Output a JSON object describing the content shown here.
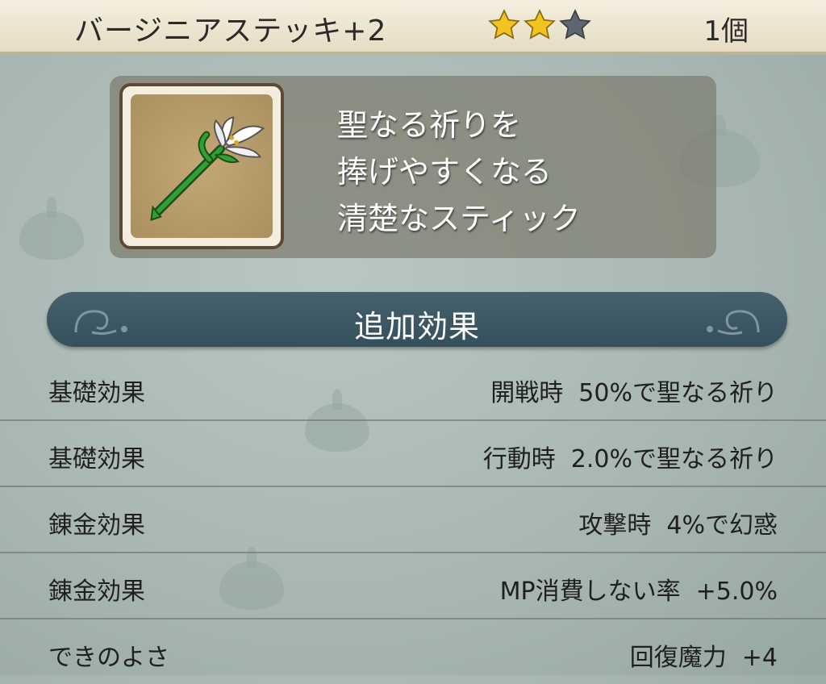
{
  "header": {
    "item_name": "バージニアステッキ+2",
    "stars": {
      "filled": 2,
      "total": 3,
      "filled_color": "#f2c420",
      "empty_color": "#5e6670"
    },
    "quantity": "1個"
  },
  "item": {
    "icon": "lily-staff-icon",
    "description_lines": [
      "聖なる祈りを",
      "捧げやすくなる",
      "清楚なスティック"
    ]
  },
  "section": {
    "title": "追加効果"
  },
  "effects": [
    {
      "label": "基礎効果",
      "value": "開戦時  50%で聖なる祈り"
    },
    {
      "label": "基礎効果",
      "value": "行動時  2.0%で聖なる祈り"
    },
    {
      "label": "錬金効果",
      "value": "攻撃時  4%で幻惑"
    },
    {
      "label": "錬金効果",
      "value": "MP消費しない率  +5.0%"
    },
    {
      "label": "できのよさ",
      "value": "回復魔力  +4"
    }
  ],
  "colors": {
    "banner": "#3b5763",
    "header": "#efe8d4",
    "panel": "#7d7d6e"
  }
}
